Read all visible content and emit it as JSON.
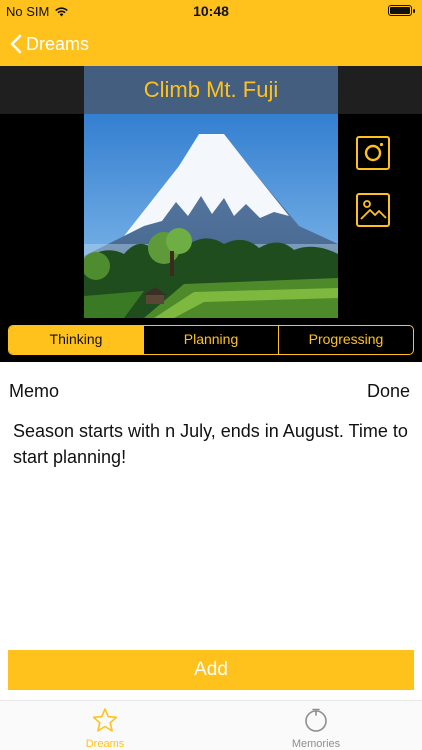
{
  "status": {
    "carrier": "No SIM",
    "time": "10:48"
  },
  "nav": {
    "back_label": "Dreams"
  },
  "dream": {
    "title": "Climb Mt. Fuji"
  },
  "segments": [
    {
      "label": "Thinking",
      "active": true
    },
    {
      "label": "Planning",
      "active": false
    },
    {
      "label": "Progressing",
      "active": false
    }
  ],
  "memo": {
    "label": "Memo",
    "done_label": "Done",
    "text": "Season starts with n July, ends in August. Time to start planning!"
  },
  "add_button": {
    "label": "Add"
  },
  "tabs": [
    {
      "label": "Dreams",
      "icon": "star-icon",
      "active": true
    },
    {
      "label": "Memories",
      "icon": "timer-icon",
      "active": false
    }
  ],
  "colors": {
    "accent": "#ffc21c",
    "tab_inactive": "#8e8e93",
    "dark_background": "#000000"
  },
  "icons": {
    "camera": "camera-icon",
    "gallery": "image-gallery-icon",
    "back": "chevron-left-icon",
    "wifi": "wifi-icon",
    "battery": "battery-icon"
  }
}
